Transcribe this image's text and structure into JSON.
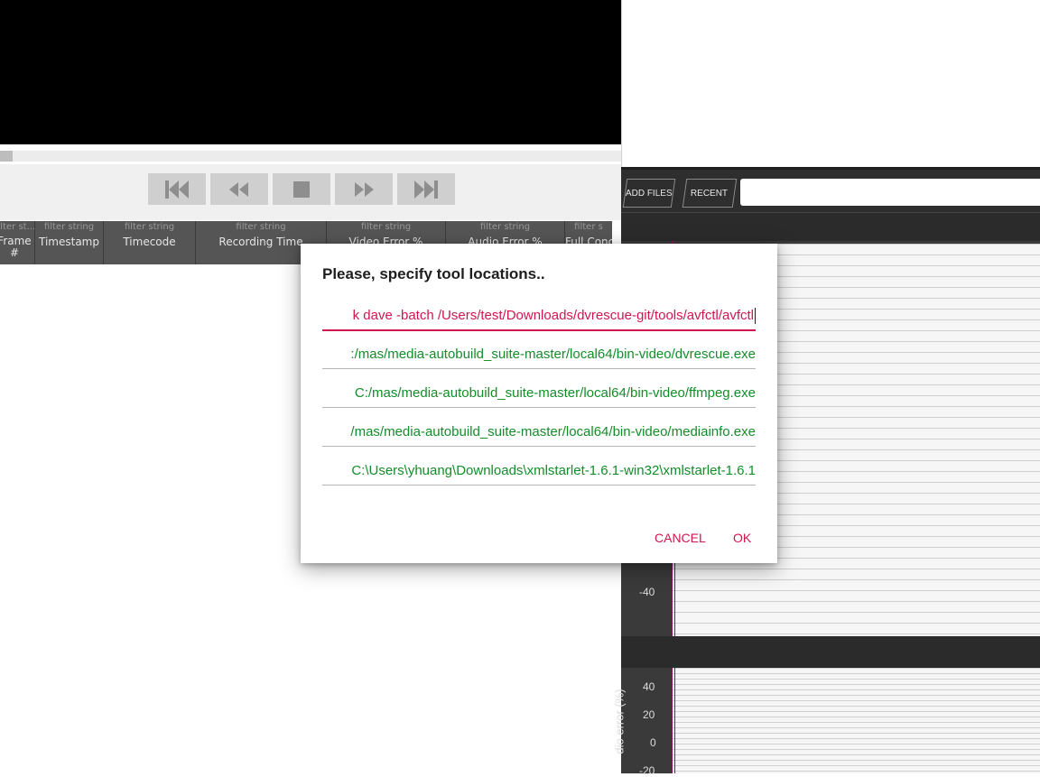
{
  "player": {
    "buttons": [
      "skip-start",
      "rewind",
      "stop",
      "fast-forward",
      "skip-end"
    ]
  },
  "table": {
    "filter_placeholder": "filter string",
    "columns": [
      {
        "filter": "filter st...",
        "name": "Frame #"
      },
      {
        "filter": "filter string",
        "name": "Timestamp"
      },
      {
        "filter": "filter string",
        "name": "Timecode"
      },
      {
        "filter": "filter string",
        "name": "Recording Time"
      },
      {
        "filter": "filter string",
        "name": "Video Error %"
      },
      {
        "filter": "filter string",
        "name": "Audio Error %"
      },
      {
        "filter": "filter s",
        "name": "Full Conc"
      }
    ]
  },
  "toolbar": {
    "add_files": "ADD FILES",
    "recent": "RECENT",
    "search_value": ""
  },
  "graph_video": {
    "ticks": [
      "-40"
    ]
  },
  "graph_audio": {
    "ylabel": "dio error (%)",
    "ticks": [
      "40",
      "20",
      "0",
      "-20"
    ]
  },
  "dialog": {
    "title": "Please, specify tool locations..",
    "fields": [
      "k dave -batch /Users/test/Downloads/dvrescue-git/tools/avfctl/avfctl",
      ":/mas/media-autobuild_suite-master/local64/bin-video/dvrescue.exe",
      "C:/mas/media-autobuild_suite-master/local64/bin-video/ffmpeg.exe",
      "/mas/media-autobuild_suite-master/local64/bin-video/mediainfo.exe",
      "C:\\Users\\yhuang\\Downloads\\xmlstarlet-1.6.1-win32\\xmlstarlet-1.6.1"
    ],
    "cancel_label": "CANCEL",
    "ok_label": "OK"
  },
  "colors": {
    "accent": "#d0164f",
    "valid_path": "#138d2a"
  }
}
